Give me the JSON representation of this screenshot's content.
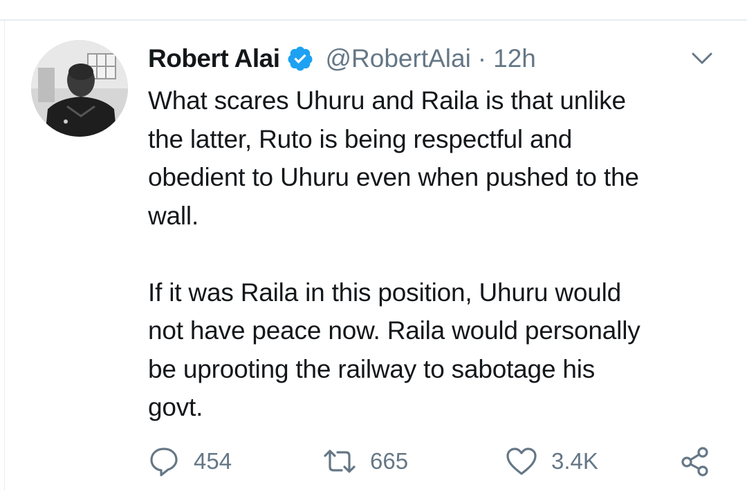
{
  "tweet": {
    "author_name": "Robert Alai",
    "handle": "@RobertAlai",
    "separator": "·",
    "time": "12h",
    "verified": true,
    "text": "What scares Uhuru and Raila is that unlike\nthe latter, Ruto is being respectful and\nobedient to Uhuru even when pushed to the\nwall.\n\nIf it was Raila in this position, Uhuru would\nnot have peace now. Raila would personally\nbe uprooting the railway to sabotage his\ngovt."
  },
  "actions": {
    "reply_count": "454",
    "retweet_count": "665",
    "like_count": "3.4K"
  },
  "icons": {
    "verified": "verified-badge-icon",
    "menu": "chevron-down-icon",
    "reply": "reply-icon",
    "retweet": "retweet-icon",
    "like": "heart-icon",
    "share": "share-icon"
  },
  "colors": {
    "text": "#14171a",
    "muted": "#657786",
    "verified": "#1da1f2",
    "border": "#e6ecf0"
  }
}
